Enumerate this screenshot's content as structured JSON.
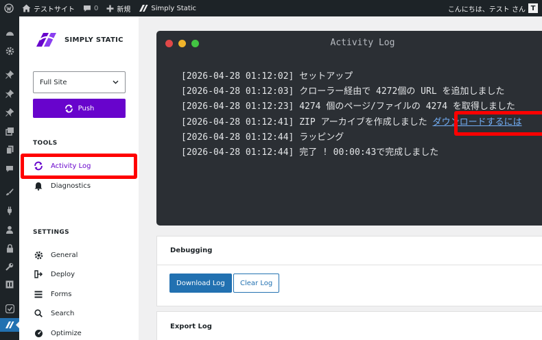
{
  "admin_bar": {
    "site_name": "テストサイト",
    "comments_count": "0",
    "new_label": "新規",
    "plugin_label": "Simply Static",
    "greeting": "こんにちは、テスト さん",
    "avatar_letter": "T"
  },
  "sidebar": {
    "logo_text": "SIMPLY STATIC",
    "select_value": "Full Site",
    "push_label": "Push",
    "tools_heading": "TOOLS",
    "tools": [
      {
        "label": "Activity Log",
        "icon": "sync-icon"
      },
      {
        "label": "Diagnostics",
        "icon": "bell-icon"
      }
    ],
    "settings_heading": "SETTINGS",
    "settings": [
      {
        "label": "General",
        "icon": "gear-icon"
      },
      {
        "label": "Deploy",
        "icon": "deploy-icon"
      },
      {
        "label": "Forms",
        "icon": "forms-icon"
      },
      {
        "label": "Search",
        "icon": "search-icon"
      },
      {
        "label": "Optimize",
        "icon": "dashboard-icon"
      }
    ]
  },
  "terminal": {
    "title": "Activity Log",
    "lines": [
      {
        "time": "[2026-04-28 01:12:02]",
        "text": "セットアップ"
      },
      {
        "time": "[2026-04-28 01:12:03]",
        "text": "クローラー経由で 4272個の URL を追加しました"
      },
      {
        "time": "[2026-04-28 01:12:23]",
        "text": "4274 個のページ/ファイルの 4274 を取得しました"
      },
      {
        "time": "[2026-04-28 01:12:41]",
        "text": "ZIP アーカイブを作成しました",
        "link": "ダウンロードするには"
      },
      {
        "time": "[2026-04-28 01:12:44]",
        "text": "ラッピング"
      },
      {
        "time": "[2026-04-28 01:12:44]",
        "text": "完了 ! 00:00:43で完成しました"
      }
    ]
  },
  "debugging": {
    "title": "Debugging",
    "download_label": "Download Log",
    "clear_label": "Clear Log"
  },
  "export": {
    "title": "Export Log"
  },
  "colors": {
    "accent": "#6804cc",
    "wp_blue": "#2271b1",
    "highlight": "#ff0000",
    "terminal_bg": "#2b2f34"
  }
}
